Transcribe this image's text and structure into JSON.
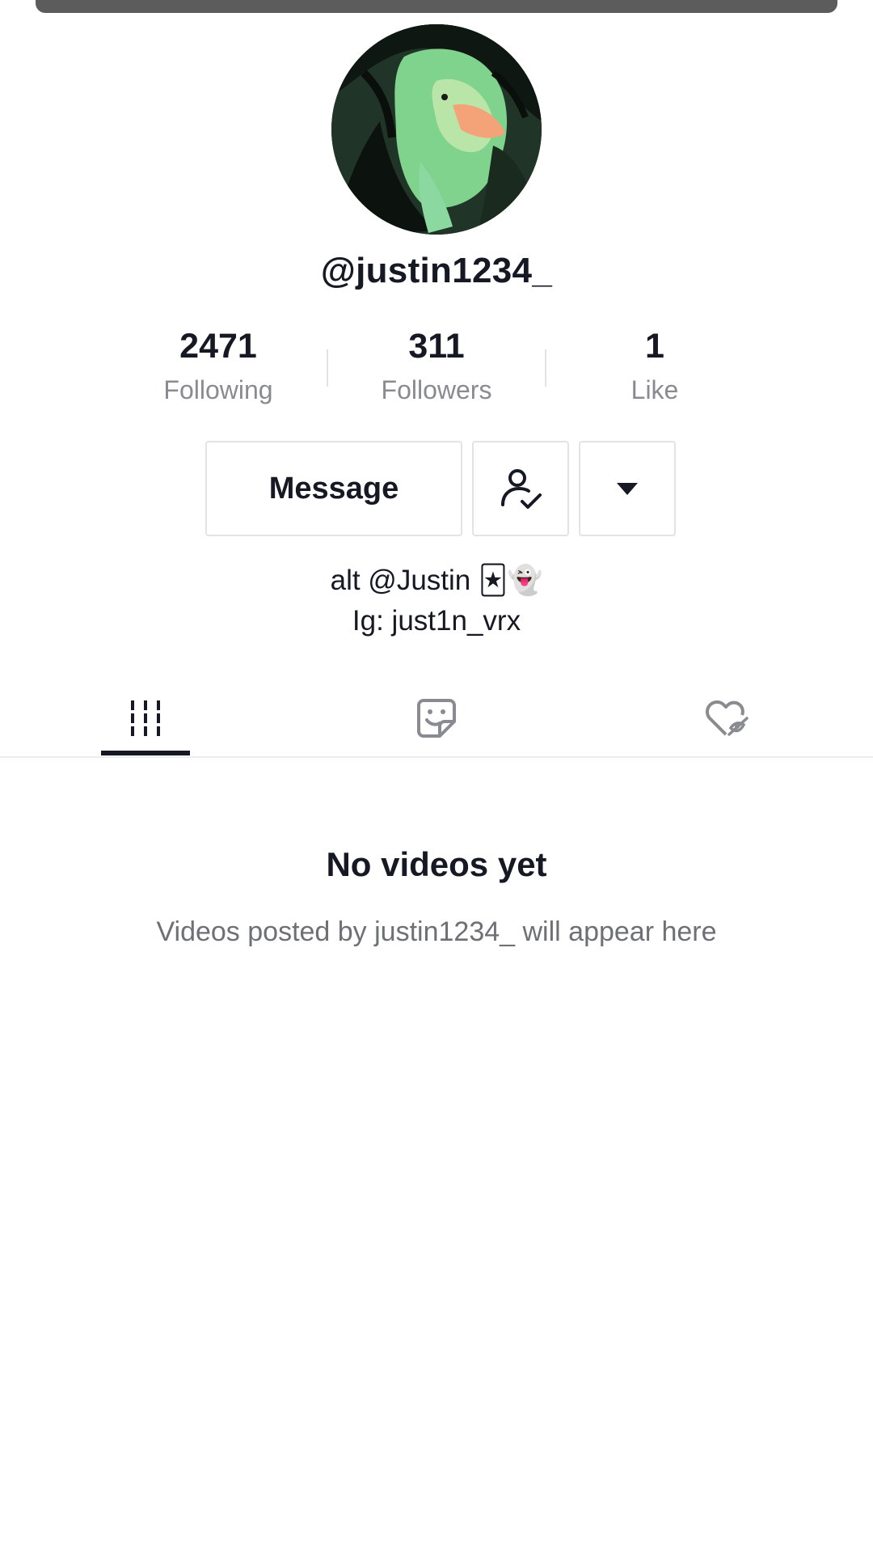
{
  "profile": {
    "username": "@justin1234_",
    "avatar_alt": "profile-photo"
  },
  "stats": [
    {
      "value": "2471",
      "label": "Following"
    },
    {
      "value": "311",
      "label": "Followers"
    },
    {
      "value": "1",
      "label": "Like"
    }
  ],
  "actions": {
    "message_label": "Message",
    "follow_icon": "user-check-icon",
    "more_icon": "caret-down-icon"
  },
  "bio": {
    "line1": "alt @Justin 🃏👻",
    "line2": "Ig: just1n_vrx"
  },
  "tabs": [
    {
      "name": "videos",
      "icon": "grid-icon",
      "active": true
    },
    {
      "name": "reposts",
      "icon": "sticker-icon",
      "active": false
    },
    {
      "name": "liked",
      "icon": "hidden-heart-icon",
      "active": false
    }
  ],
  "empty_state": {
    "title": "No videos yet",
    "subtitle": "Videos posted by justin1234_ will appear here"
  },
  "colors": {
    "text": "#161823",
    "muted": "#8a8b91",
    "border": "#e3e3e4",
    "handle": "#5c5c5c"
  }
}
